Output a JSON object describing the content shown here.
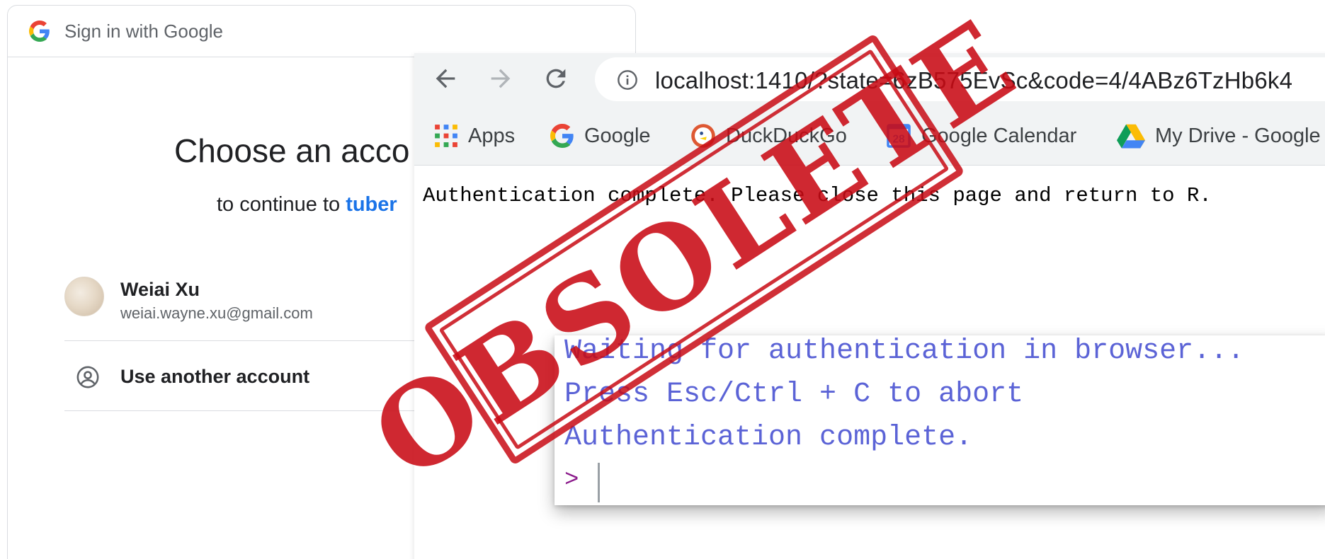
{
  "signin": {
    "header_title": "Sign in with Google",
    "heading": "Choose an acco",
    "subheading_prefix": "to continue to ",
    "app_name": "tuber",
    "accounts": [
      {
        "name": "Weiai Xu",
        "email": "weiai.wayne.xu@gmail.com"
      }
    ],
    "use_another_account": "Use another account"
  },
  "browser": {
    "url": "localhost:1410/?state=6zB575EvSc&code=4/4ABz6TzHb6k4",
    "bookmarks": [
      {
        "label": "Apps",
        "icon": "apps-grid-icon"
      },
      {
        "label": "Google",
        "icon": "google-icon"
      },
      {
        "label": "DuckDuckGo",
        "icon": "duckduckgo-icon"
      },
      {
        "label": "Google Calendar",
        "icon": "calendar-icon",
        "badge": "28"
      },
      {
        "label": "My Drive - Google",
        "icon": "drive-icon"
      }
    ],
    "page_text": "Authentication complete. Please close this page and return to R."
  },
  "console": {
    "lines": [
      "Waiting for authentication in browser...",
      "Press Esc/Ctrl + C to abort",
      "Authentication complete."
    ],
    "prompt": ">"
  },
  "stamp": {
    "text": "OBSOLETE"
  },
  "colors": {
    "google_blue": "#1a73e8",
    "stamp_red": "#c80a14",
    "console_text": "#5b63d6",
    "prompt": "#8b1a8b",
    "chrome_toolbar": "#f1f3f4"
  }
}
